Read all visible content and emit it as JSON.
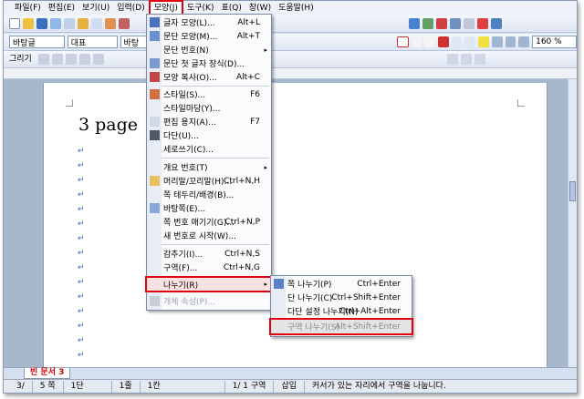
{
  "menubar": {
    "items": [
      "파일(F)",
      "편집(E)",
      "보기(U)",
      "입력(D)",
      "모양(J)",
      "도구(K)",
      "표(Q)",
      "창(W)",
      "도움말(H)"
    ]
  },
  "toolbar2": {
    "style": "바탕글",
    "font_en": "대표",
    "font_ko": "바탕",
    "zoom": "160 %"
  },
  "toolbar3": {
    "draw": "그리기"
  },
  "document": {
    "heading": "3 page",
    "para_mark": "↵"
  },
  "format_menu": {
    "items": [
      {
        "label": "글자 모양(L)...",
        "shortcut": "Alt+L"
      },
      {
        "label": "문단 모양(M)...",
        "shortcut": "Alt+T"
      },
      {
        "label": "문단 번호(N)"
      },
      {
        "label": "문단 첫 글자 장식(D)..."
      },
      {
        "label": "모양 복사(O)...",
        "shortcut": "Alt+C"
      },
      {
        "label": "스타일(S)...",
        "shortcut": "F6"
      },
      {
        "label": "스타일마당(Y)..."
      },
      {
        "label": "편집 용지(A)...",
        "shortcut": "F7"
      },
      {
        "label": "다단(U)..."
      },
      {
        "label": "세로쓰기(C)..."
      },
      {
        "label": "개요 번호(T)"
      },
      {
        "label": "머리말/꼬리말(H)...",
        "shortcut": "Ctrl+N,H"
      },
      {
        "label": "쪽 테두리/배경(B)..."
      },
      {
        "label": "바탕쪽(E)..."
      },
      {
        "label": "쪽 번호 매기기(G)...",
        "shortcut": "Ctrl+N,P"
      },
      {
        "label": "새 번호로 시작(W)..."
      },
      {
        "label": "감추기(I)...",
        "shortcut": "Ctrl+N,S"
      },
      {
        "label": "구역(F)...",
        "shortcut": "Ctrl+N,G"
      },
      {
        "label": "나누기(R)"
      },
      {
        "label": "개체 속성(P)..."
      }
    ]
  },
  "break_menu": {
    "items": [
      {
        "label": "쪽 나누기(P)",
        "shortcut": "Ctrl+Enter"
      },
      {
        "label": "단 나누기(C)",
        "shortcut": "Ctrl+Shift+Enter"
      },
      {
        "label": "다단 설정 나누기(N)",
        "shortcut": "Ctrl+Alt+Enter"
      },
      {
        "label": "구역 나누기(S)",
        "shortcut": "Alt+Shift+Enter"
      }
    ]
  },
  "tabbar": {
    "tab": "빈 문서 3"
  },
  "status": {
    "page": "3/",
    "total": "5 쪽",
    "para": "1단",
    "line": "1줄",
    "col": "1칸",
    "section": "1/ 1 구역",
    "mode": "삽입",
    "message": "커서가 있는 자리에서 구역을 나눕니다."
  },
  "colors": {
    "highlight": "#e00010",
    "para_mark": "#3b67c4"
  }
}
